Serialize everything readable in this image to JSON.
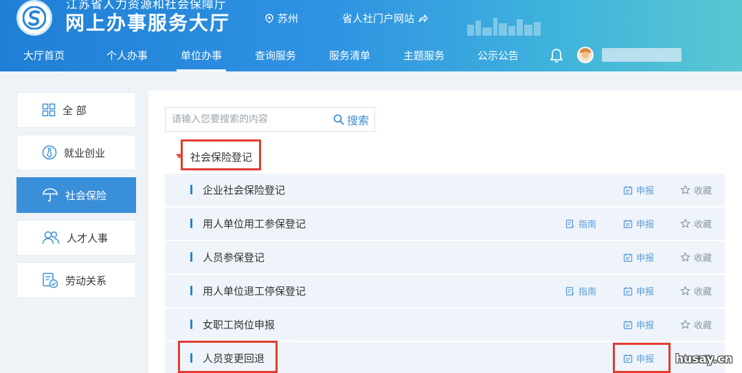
{
  "header": {
    "department": "江苏省人力资源和社会保障厅",
    "title": "网上办事服务大厅",
    "location": "苏州",
    "portal_link": "省人社门户网站",
    "nav": [
      "大厅首页",
      "个人办事",
      "单位办事",
      "查询服务",
      "服务清单",
      "主题服务",
      "公示公告"
    ],
    "active_nav": "单位办事",
    "icons": {
      "location": "location-pin-icon",
      "portal": "share-arrow-icon",
      "notification": "bell-icon",
      "user": "avatar"
    }
  },
  "sidebar": {
    "items": [
      {
        "label": "全 部",
        "icon": "grid-icon"
      },
      {
        "label": "就业创业",
        "icon": "employment-icon"
      },
      {
        "label": "社会保险",
        "icon": "umbrella-icon"
      },
      {
        "label": "人才人事",
        "icon": "people-icon"
      },
      {
        "label": "劳动关系",
        "icon": "document-icon"
      }
    ],
    "active": "社会保险"
  },
  "search": {
    "placeholder": "请输入您要搜索的内容",
    "button": "搜索"
  },
  "category": "社会保险登记",
  "actions": {
    "guide": "指南",
    "apply": "申报",
    "favorite": "收藏"
  },
  "services": [
    {
      "name": "企业社会保险登记",
      "has_guide": false
    },
    {
      "name": "用人单位用工参保登记",
      "has_guide": true
    },
    {
      "name": "人员参保登记",
      "has_guide": false
    },
    {
      "name": "用人单位退工停保登记",
      "has_guide": true
    },
    {
      "name": "女职工岗位申报",
      "has_guide": false
    },
    {
      "name": "人员变更回退",
      "has_guide": false
    }
  ],
  "watermark": "husay.cn",
  "colors": {
    "primary": "#3a8fd9",
    "highlight": "#e23a2e"
  }
}
